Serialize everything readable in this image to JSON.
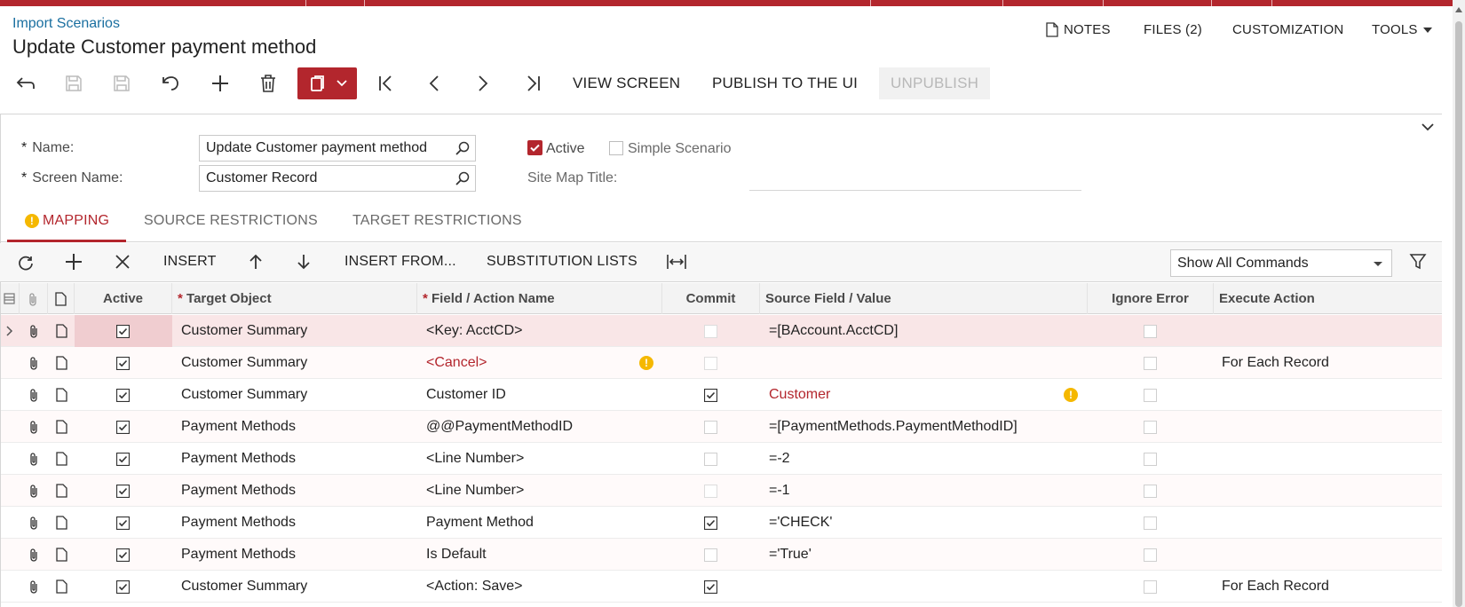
{
  "breadcrumb": "Import Scenarios",
  "title": "Update Customer payment method",
  "topnav": {
    "notes": "NOTES",
    "files": "FILES (2)",
    "customization": "CUSTOMIZATION",
    "tools": "TOOLS"
  },
  "toolbar": {
    "view_screen": "VIEW SCREEN",
    "publish": "PUBLISH TO THE UI",
    "unpublish": "UNPUBLISH",
    "icons": [
      "back-icon",
      "save-close-icon",
      "save-icon",
      "undo-icon",
      "add-icon",
      "delete-icon",
      "paste-icon",
      "first-icon",
      "prev-icon",
      "next-icon",
      "last-icon"
    ]
  },
  "form": {
    "name_label": "Name:",
    "name_value": "Update Customer payment method",
    "screen_label": "Screen Name:",
    "screen_value": "Customer Record",
    "active_label": "Active",
    "active_checked": true,
    "simple_label": "Simple Scenario",
    "simple_checked": false,
    "sitemap_label": "Site Map Title:",
    "sitemap_value": ""
  },
  "tabs": [
    "MAPPING",
    "SOURCE RESTRICTIONS",
    "TARGET RESTRICTIONS"
  ],
  "active_tab": "MAPPING",
  "grid_toolbar": {
    "insert": "INSERT",
    "insert_from": "INSERT FROM...",
    "substitution": "SUBSTITUTION LISTS",
    "filter_select": "Show All Commands"
  },
  "columns": [
    "Active",
    "Target Object",
    "Field / Action Name",
    "Commit",
    "Source Field / Value",
    "Ignore Error",
    "Execute Action"
  ],
  "rows": [
    {
      "active": true,
      "target": "Customer Summary",
      "field": "<Key: AcctCD>",
      "field_red": false,
      "field_warn": false,
      "commit": false,
      "commit_disabled": true,
      "source": "=[BAccount.AcctCD]",
      "source_red": false,
      "source_warn": false,
      "ignore": false,
      "execute": ""
    },
    {
      "active": true,
      "target": "Customer Summary",
      "field": "<Cancel>",
      "field_red": true,
      "field_warn": true,
      "commit": false,
      "commit_disabled": true,
      "source": "",
      "source_red": false,
      "source_warn": false,
      "ignore": false,
      "execute": "For Each Record"
    },
    {
      "active": true,
      "target": "Customer Summary",
      "field": "Customer ID",
      "field_red": false,
      "field_warn": false,
      "commit": true,
      "commit_disabled": false,
      "source": "Customer",
      "source_red": true,
      "source_warn": true,
      "ignore": false,
      "execute": ""
    },
    {
      "active": true,
      "target": "Payment Methods",
      "field": "@@PaymentMethodID",
      "field_red": false,
      "field_warn": false,
      "commit": false,
      "commit_disabled": false,
      "source": "=[PaymentMethods.PaymentMethodID]",
      "source_red": false,
      "source_warn": false,
      "ignore": false,
      "execute": ""
    },
    {
      "active": true,
      "target": "Payment Methods",
      "field": "<Line Number>",
      "field_red": false,
      "field_warn": false,
      "commit": false,
      "commit_disabled": false,
      "source": "=-2",
      "source_red": false,
      "source_warn": false,
      "ignore": false,
      "execute": ""
    },
    {
      "active": true,
      "target": "Payment Methods",
      "field": "<Line Number>",
      "field_red": false,
      "field_warn": false,
      "commit": false,
      "commit_disabled": true,
      "source": "=-1",
      "source_red": false,
      "source_warn": false,
      "ignore": false,
      "execute": ""
    },
    {
      "active": true,
      "target": "Payment Methods",
      "field": "Payment Method",
      "field_red": false,
      "field_warn": false,
      "commit": true,
      "commit_disabled": false,
      "source": "='CHECK'",
      "source_red": false,
      "source_warn": false,
      "ignore": false,
      "execute": ""
    },
    {
      "active": true,
      "target": "Payment Methods",
      "field": "Is Default",
      "field_red": false,
      "field_warn": false,
      "commit": false,
      "commit_disabled": false,
      "source": "='True'",
      "source_red": false,
      "source_warn": false,
      "ignore": false,
      "execute": ""
    },
    {
      "active": true,
      "target": "Customer Summary",
      "field": "<Action: Save>",
      "field_red": false,
      "field_warn": false,
      "commit": true,
      "commit_disabled": false,
      "source": "",
      "source_red": false,
      "source_warn": false,
      "ignore": false,
      "execute": "For Each Record"
    }
  ],
  "colors": {
    "brand": "#b3262d",
    "link": "#1a6fa0",
    "warn": "#f5b800"
  }
}
